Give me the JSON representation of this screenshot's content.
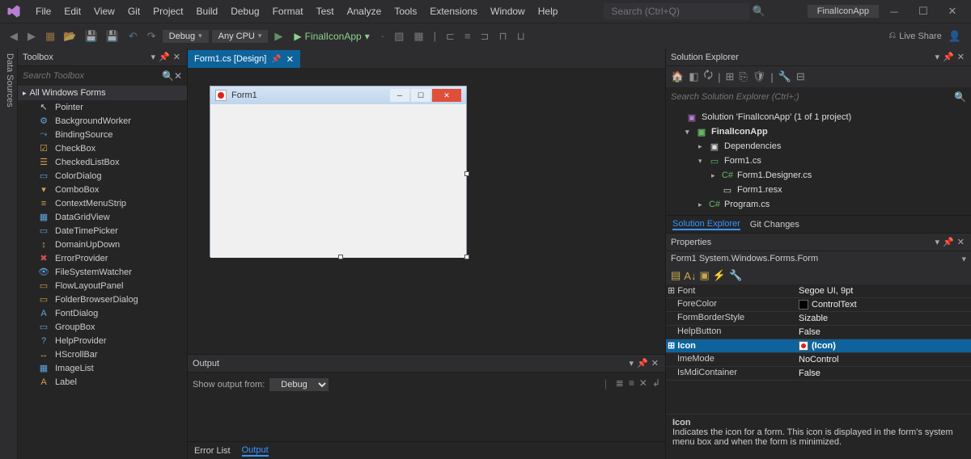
{
  "menubar": {
    "items": [
      "File",
      "Edit",
      "View",
      "Git",
      "Project",
      "Build",
      "Debug",
      "Format",
      "Test",
      "Analyze",
      "Tools",
      "Extensions",
      "Window",
      "Help"
    ],
    "search_placeholder": "Search (Ctrl+Q)",
    "app_name": "FinalIconApp"
  },
  "toolbar": {
    "config": "Debug",
    "platform": "Any CPU",
    "run_target": "FinalIconApp",
    "liveshare": "Live Share"
  },
  "sidebar_tab": "Data Sources",
  "toolbox": {
    "title": "Toolbox",
    "search_placeholder": "Search Toolbox",
    "category": "All Windows Forms",
    "items": [
      {
        "icon": "↖",
        "name": "Pointer",
        "color": "#ccc"
      },
      {
        "icon": "⚙",
        "name": "BackgroundWorker",
        "color": "#5da6e0"
      },
      {
        "icon": "⤳",
        "name": "BindingSource",
        "color": "#5da6e0"
      },
      {
        "icon": "☑",
        "name": "CheckBox",
        "color": "#d1a24a"
      },
      {
        "icon": "☰",
        "name": "CheckedListBox",
        "color": "#d1a24a"
      },
      {
        "icon": "▭",
        "name": "ColorDialog",
        "color": "#5da6e0"
      },
      {
        "icon": "▾",
        "name": "ComboBox",
        "color": "#d1a24a"
      },
      {
        "icon": "≡",
        "name": "ContextMenuStrip",
        "color": "#d1a24a"
      },
      {
        "icon": "▦",
        "name": "DataGridView",
        "color": "#5da6e0"
      },
      {
        "icon": "▭",
        "name": "DateTimePicker",
        "color": "#5da6e0"
      },
      {
        "icon": "↕",
        "name": "DomainUpDown",
        "color": "#d1a24a"
      },
      {
        "icon": "✖",
        "name": "ErrorProvider",
        "color": "#d05050"
      },
      {
        "icon": "👁",
        "name": "FileSystemWatcher",
        "color": "#5da6e0"
      },
      {
        "icon": "▭",
        "name": "FlowLayoutPanel",
        "color": "#d1a24a"
      },
      {
        "icon": "▭",
        "name": "FolderBrowserDialog",
        "color": "#d1a24a"
      },
      {
        "icon": "A",
        "name": "FontDialog",
        "color": "#5da6e0"
      },
      {
        "icon": "▭",
        "name": "GroupBox",
        "color": "#5da6e0"
      },
      {
        "icon": "?",
        "name": "HelpProvider",
        "color": "#5da6e0"
      },
      {
        "icon": "↔",
        "name": "HScrollBar",
        "color": "#d1a24a"
      },
      {
        "icon": "▦",
        "name": "ImageList",
        "color": "#5da6e0"
      },
      {
        "icon": "A",
        "name": "Label",
        "color": "#d1a24a"
      }
    ]
  },
  "document": {
    "tab_title": "Form1.cs [Design]",
    "form_title": "Form1"
  },
  "output": {
    "title": "Output",
    "from_label": "Show output from:",
    "from_value": "Debug",
    "tabs": [
      "Error List",
      "Output"
    ]
  },
  "solution": {
    "title": "Solution Explorer",
    "search_placeholder": "Search Solution Explorer (Ctrl+;)",
    "root": "Solution 'FinalIconApp' (1 of 1 project)",
    "project": "FinalIconApp",
    "nodes": {
      "dependencies": "Dependencies",
      "form": "Form1.cs",
      "designer": "Form1.Designer.cs",
      "resx": "Form1.resx",
      "program": "Program.cs"
    },
    "tabs": [
      "Solution Explorer",
      "Git Changes"
    ]
  },
  "properties": {
    "title": "Properties",
    "object": "Form1  System.Windows.Forms.Form",
    "rows": [
      {
        "cat": true,
        "name": "Font",
        "value": "Segoe UI, 9pt"
      },
      {
        "name": "ForeColor",
        "value": "ControlText",
        "swatch": "#000"
      },
      {
        "name": "FormBorderStyle",
        "value": "Sizable"
      },
      {
        "name": "HelpButton",
        "value": "False"
      },
      {
        "cat": true,
        "name": "Icon",
        "value": "(Icon)",
        "selected": true,
        "iconswatch": true
      },
      {
        "name": "ImeMode",
        "value": "NoControl"
      },
      {
        "name": "IsMdiContainer",
        "value": "False"
      }
    ],
    "desc_title": "Icon",
    "desc_text": "Indicates the icon for a form. This icon is displayed in the form's system menu box and when the form is minimized."
  }
}
